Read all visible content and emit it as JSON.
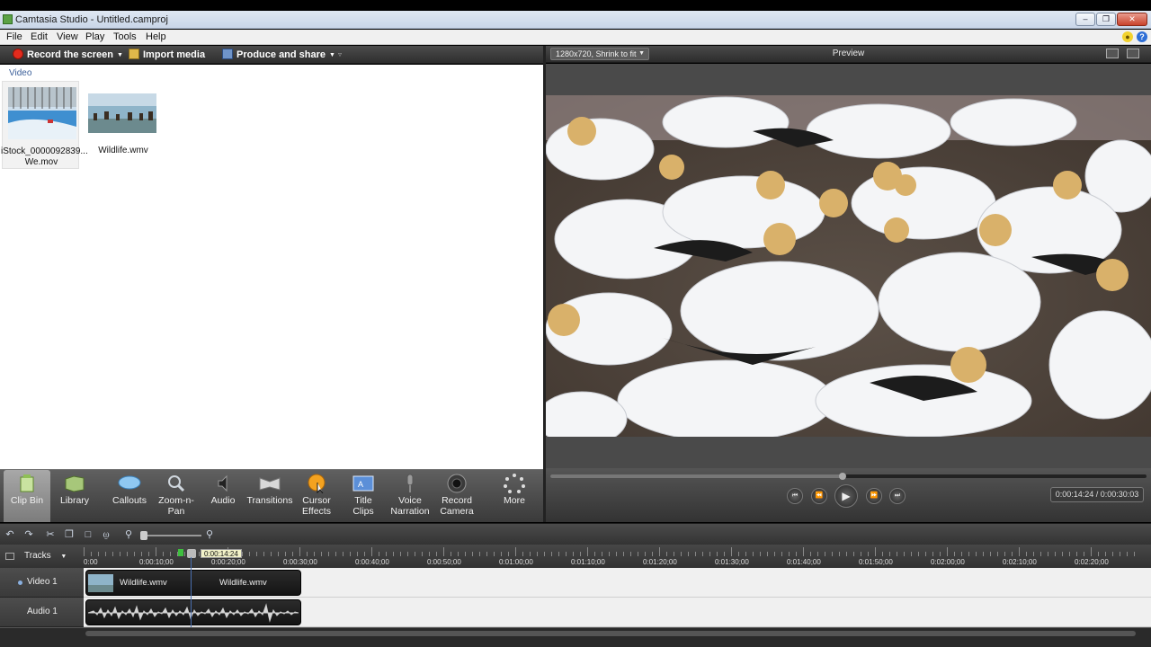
{
  "window": {
    "title": "Camtasia Studio - Untitled.camproj"
  },
  "menu": [
    "File",
    "Edit",
    "View",
    "Play",
    "Tools",
    "Help"
  ],
  "toolbar": {
    "record_label": "Record the screen",
    "import_label": "Import media",
    "produce_label": "Produce and share"
  },
  "clipbin": {
    "section": "Video",
    "items": [
      {
        "label_line1": "iStock_0000092839...",
        "label_line2": "We.mov"
      },
      {
        "label_line1": "Wildlife.wmv",
        "label_line2": ""
      }
    ]
  },
  "tabs": [
    {
      "line1": "Clip Bin",
      "line2": ""
    },
    {
      "line1": "Library",
      "line2": ""
    },
    {
      "line1": "Callouts",
      "line2": ""
    },
    {
      "line1": "Zoom-n-",
      "line2": "Pan"
    },
    {
      "line1": "Audio",
      "line2": ""
    },
    {
      "line1": "Transitions",
      "line2": ""
    },
    {
      "line1": "Cursor",
      "line2": "Effects"
    },
    {
      "line1": "Title",
      "line2": "Clips"
    },
    {
      "line1": "Voice",
      "line2": "Narration"
    },
    {
      "line1": "Record",
      "line2": "Camera"
    },
    {
      "line1": "More",
      "line2": ""
    }
  ],
  "preview": {
    "size_option": "1280x720, Shrink to fit",
    "title": "Preview",
    "time_display": "0:00:14:24 / 0:00:30:03",
    "progress": 0.49
  },
  "timeline": {
    "tracks_label": "Tracks",
    "playhead_time": "0:00:14:24",
    "ruler": [
      "0:00",
      "0:00:10;00",
      "0:00:20;00",
      "0:00:30;00",
      "0:00:40;00",
      "0:00:50;00",
      "0:01:00;00",
      "0:01:10;00",
      "0:01:20;00",
      "0:01:30;00",
      "0:01:40;00",
      "0:01:50;00",
      "0:02:00;00",
      "0:02:10;00",
      "0:02:20;00"
    ],
    "video_track": "Video 1",
    "audio_track": "Audio 1",
    "clip_a": "Wildlife.wmv",
    "clip_b": "Wildlife.wmv"
  }
}
